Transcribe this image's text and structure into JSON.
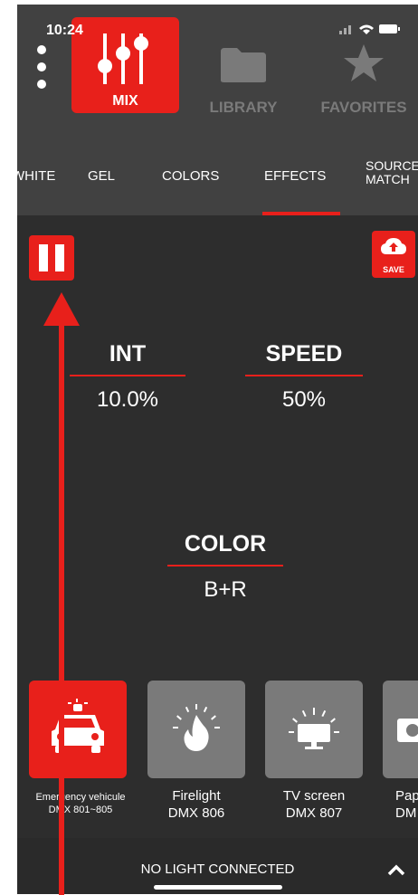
{
  "status": {
    "time": "10:24",
    "icons": "wifi battery"
  },
  "topnav": {
    "tabs": [
      {
        "label": "MIX",
        "icon": "sliders-icon",
        "active": true
      },
      {
        "label": "LIBRARY",
        "icon": "folder-icon",
        "active": false
      },
      {
        "label": "FAVORITES",
        "icon": "star-icon",
        "active": false
      }
    ]
  },
  "subnav": {
    "tabs": [
      {
        "label": "WHITE"
      },
      {
        "label": "GEL"
      },
      {
        "label": "COLORS"
      },
      {
        "label": "EFFECTS",
        "active": true
      },
      {
        "label": "SOURCE MATCH"
      }
    ]
  },
  "controls": {
    "save_label": "SAVE"
  },
  "params": [
    {
      "name": "INT",
      "value": "10.0%"
    },
    {
      "name": "SPEED",
      "value": "50%"
    },
    {
      "name": "COLOR",
      "value": "B+R"
    }
  ],
  "effects": [
    {
      "line1": "Emergency vehicule",
      "line2": "DMX 801~805",
      "active": true
    },
    {
      "line1": "Firelight",
      "line2": "DMX 806"
    },
    {
      "line1": "TV screen",
      "line2": "DMX 807"
    },
    {
      "line1": "Pap",
      "line2": "DM"
    }
  ],
  "bottom": {
    "status": "NO LIGHT CONNECTED"
  },
  "colors": {
    "accent": "#e8201b",
    "bg": "#2d2d2d",
    "nav": "#414141"
  }
}
